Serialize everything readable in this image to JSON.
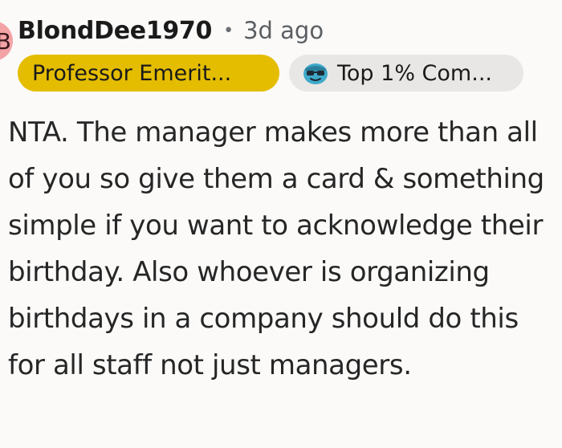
{
  "comment": {
    "author": "BlondDee1970",
    "separator": "•",
    "timestamp": "3d ago",
    "avatar_letter": "B",
    "flairs": [
      {
        "label": "Professor Emerit...",
        "background": "#e4bd00"
      },
      {
        "label": "Top 1% Com...",
        "background": "#e9e7e5",
        "icon": "sunglasses-emoji-icon"
      }
    ],
    "body": "NTA. The manager makes more than all of you so give them a card & something simple if you want to acknowledge their birthday. Also whoever is organizing birthdays in a company should do this for all staff not just managers."
  },
  "colors": {
    "avatar": "#f3a2a6",
    "page_background": "#fbfaf9"
  }
}
